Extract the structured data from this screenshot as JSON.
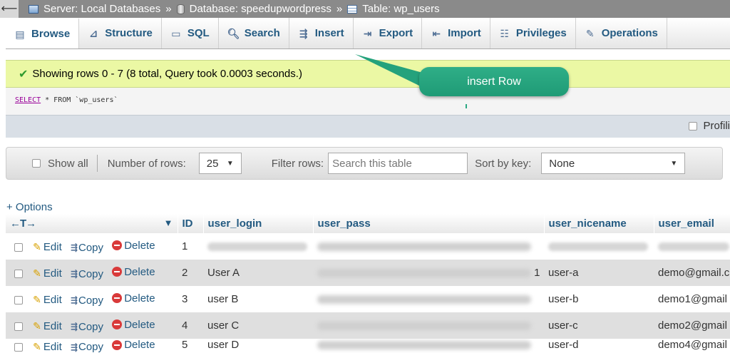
{
  "breadcrumb": {
    "back_icon": "arrow-left-icon",
    "server": "Server: Local Databases",
    "separator": "»",
    "database": "Database: speedupwordpress",
    "table": "Table: wp_users"
  },
  "tabs": [
    {
      "label": "Browse",
      "icon": "browse-icon",
      "active": true
    },
    {
      "label": "Structure",
      "icon": "structure-icon"
    },
    {
      "label": "SQL",
      "icon": "sql-icon"
    },
    {
      "label": "Search",
      "icon": "search-icon"
    },
    {
      "label": "Insert",
      "icon": "insert-icon"
    },
    {
      "label": "Export",
      "icon": "export-icon"
    },
    {
      "label": "Import",
      "icon": "import-icon"
    },
    {
      "label": "Privileges",
      "icon": "privileges-icon"
    },
    {
      "label": "Operations",
      "icon": "operations-icon"
    }
  ],
  "message": "Showing rows 0 - 7 (8 total, Query took 0.0003 seconds.)",
  "query": {
    "keyword": "SELECT",
    "rest": " * FROM `wp_users`"
  },
  "profiling_label": "Profili",
  "nav": {
    "show_all": "Show all",
    "number_of_rows_label": "Number of rows:",
    "number_of_rows_value": "25",
    "filter_label": "Filter rows:",
    "filter_placeholder": "Search this table",
    "sort_label": "Sort by key:",
    "sort_value": "None"
  },
  "options_link": "+ Options",
  "table": {
    "columns": [
      "ID",
      "user_login",
      "user_pass",
      "user_nicename",
      "user_email"
    ],
    "actions": {
      "edit": "Edit",
      "copy": "Copy",
      "delete": "Delete"
    },
    "rows": [
      {
        "id": "1",
        "login": "",
        "pass_suffix": "",
        "nicename": "",
        "email": ""
      },
      {
        "id": "2",
        "login": "User A",
        "pass_suffix": "1",
        "nicename": "user-a",
        "email": "demo@gmail.c"
      },
      {
        "id": "3",
        "login": "user B",
        "pass_suffix": "",
        "nicename": "user-b",
        "email": "demo1@gmail"
      },
      {
        "id": "4",
        "login": "user C",
        "pass_suffix": "",
        "nicename": "user-c",
        "email": "demo2@gmail"
      },
      {
        "id": "5",
        "login": "user D",
        "pass_suffix": "",
        "nicename": "user-d",
        "email": "demo4@gmail"
      }
    ]
  },
  "callout": {
    "text": "insert Row",
    "color": "#2aa882"
  }
}
